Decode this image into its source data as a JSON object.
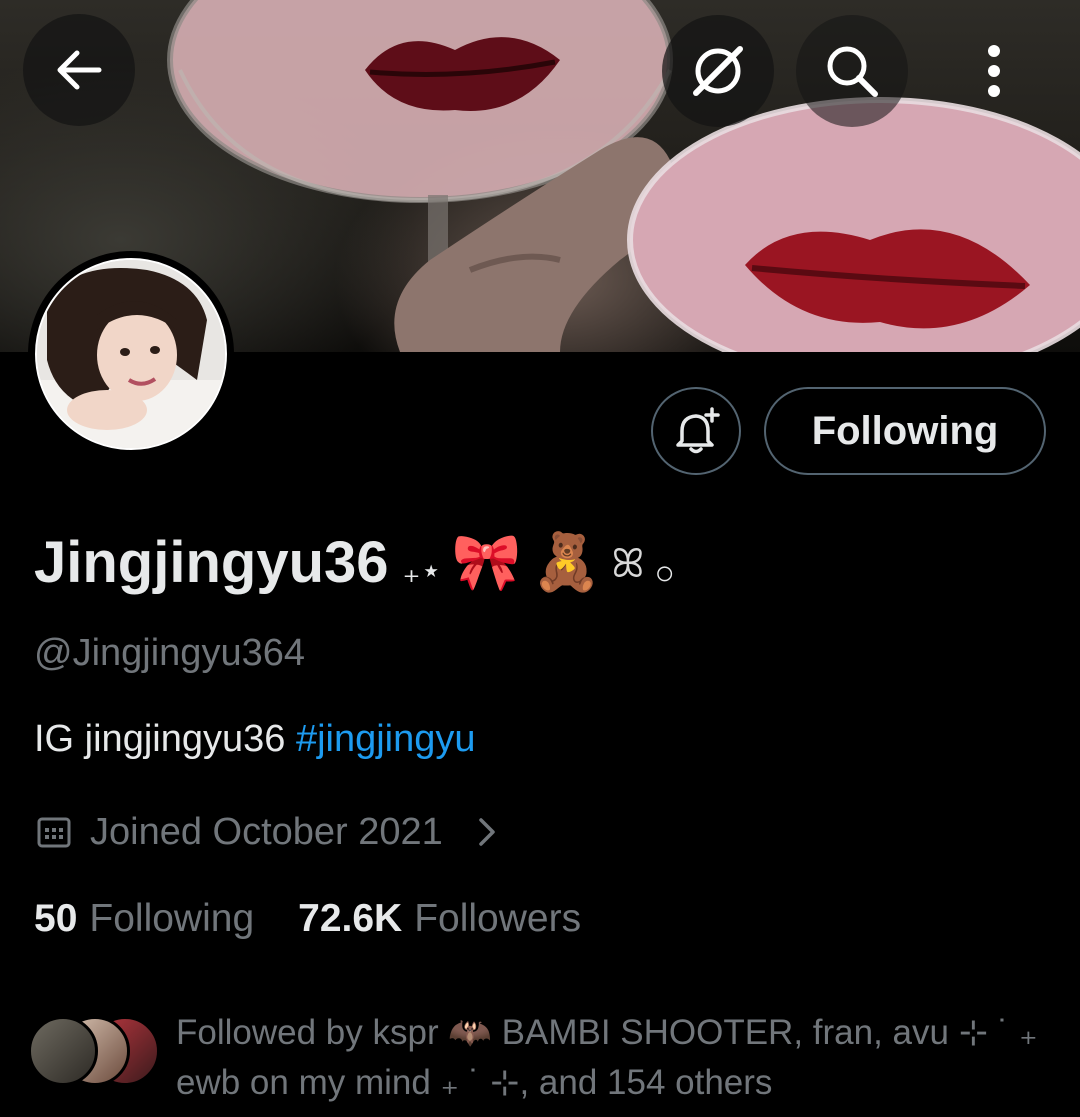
{
  "header": {
    "back_icon": "arrow-left-icon",
    "grok_icon": "grok-icon",
    "search_icon": "search-icon",
    "more_icon": "more-vertical-icon"
  },
  "profile": {
    "display_name": "Jingjingyu36",
    "name_sparkle": "₊⋆",
    "name_emoji_1": "🎀",
    "name_emoji_2": "🧸",
    "name_tail": "ꕤ",
    "name_tail_o": "○",
    "handle": "@Jingjingyu364",
    "bio_text": "IG jingjingyu36 ",
    "bio_hashtag": "#jingjingyu",
    "joined": "Joined October 2021",
    "stats": {
      "following_count": "50",
      "following_label": "Following",
      "followers_count": "72.6K",
      "followers_label": "Followers"
    },
    "followed_by_line1": "Followed by kspr 🦇 BAMBI SHOOTER, fran, avu ⊹ ˙ ₊",
    "followed_by_line2": "ewb on my mind ₊ ˙ ⊹, and 154 others"
  },
  "actions": {
    "notify_icon": "bell-plus-icon",
    "following_label": "Following"
  },
  "colors": {
    "background": "#000000",
    "text_primary": "#e7e9ea",
    "text_secondary": "#71767b",
    "link": "#1d9bf0",
    "button_border": "#536471"
  }
}
